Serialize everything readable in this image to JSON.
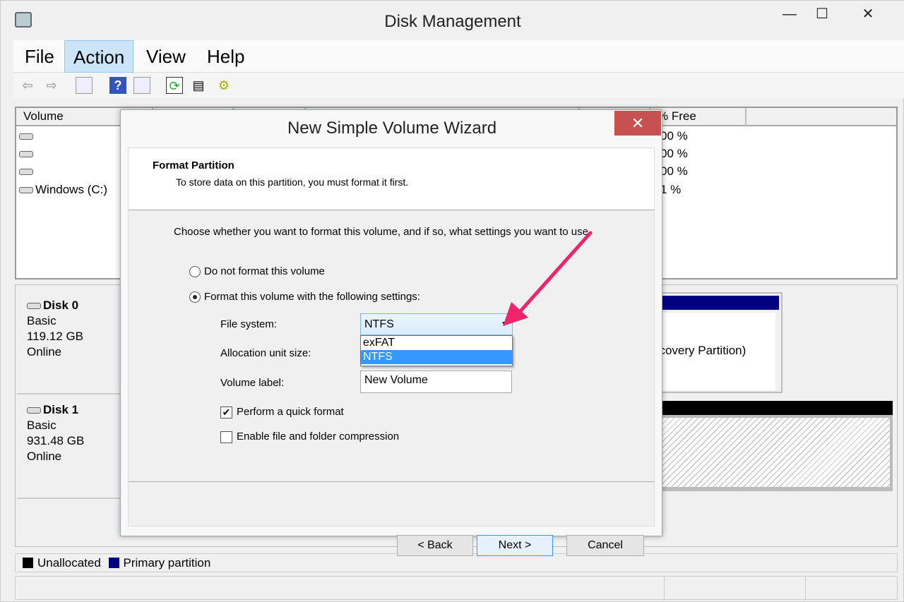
{
  "window": {
    "title": "Disk Management",
    "minimize": "—",
    "maximize": "☐",
    "close": "✕"
  },
  "menu": [
    "File",
    "Action",
    "View",
    "Help"
  ],
  "toolbar": {
    "icons": [
      "back-arrow-icon",
      "forward-arrow-icon",
      "show-hide-console-tree-icon",
      "help-icon",
      "show-hide-action-pane-icon",
      "refresh-icon",
      "properties-icon",
      "rescan-disks-icon"
    ]
  },
  "volume_list": {
    "columns": [
      "Volume",
      "",
      "",
      "",
      "",
      "",
      "",
      "% Free"
    ],
    "rows": [
      {
        "volume": "",
        "free": "00 %"
      },
      {
        "volume": "",
        "free": "00 %"
      },
      {
        "volume": "",
        "free": "00 %"
      },
      {
        "volume": "Windows (C:)",
        "free": "1 %"
      }
    ]
  },
  "disks": [
    {
      "name": "Disk 0",
      "type": "Basic",
      "size": "119.12 GB",
      "status": "Online",
      "partition_text": "ecovery Partition)"
    },
    {
      "name": "Disk 1",
      "type": "Basic",
      "size": "931.48 GB",
      "status": "Online"
    }
  ],
  "legend": [
    {
      "label": "Unallocated",
      "color": "#000000"
    },
    {
      "label": "Primary partition",
      "color": "#000080"
    }
  ],
  "dialog": {
    "title": "New Simple Volume Wizard",
    "close": "✕",
    "header_title": "Format Partition",
    "header_subtitle": "To store data on this partition, you must format it first.",
    "instruction": "Choose whether you want to format this volume, and if so, what settings you want to use.",
    "option_no_format": "Do not format this volume",
    "option_format": "Format this volume with the following settings:",
    "selected_option": "format",
    "file_system_label": "File system:",
    "file_system_value": "NTFS",
    "file_system_options": [
      "exFAT",
      "NTFS"
    ],
    "allocation_label": "Allocation unit size:",
    "volume_label_label": "Volume label:",
    "volume_label_value": "New Volume",
    "quick_format": "Perform a quick format",
    "quick_format_checked": true,
    "compression": "Enable file and folder compression",
    "compression_checked": false,
    "back": "< Back",
    "next": "Next >",
    "cancel": "Cancel"
  },
  "colors": {
    "annotation_arrow": "#f0246a",
    "close_button": "#c75050",
    "selection": "#3399ff",
    "primary_partition": "#000080"
  }
}
